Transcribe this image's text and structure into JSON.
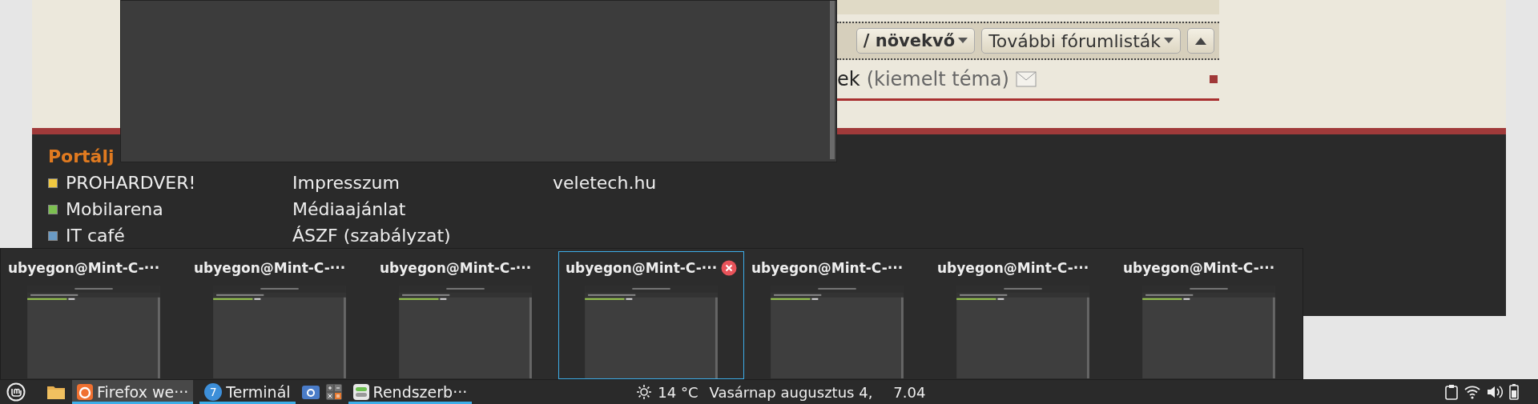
{
  "forum_page": {
    "sort_bar": {
      "sort_label": "/ növekvő",
      "forum_lists_button": "További fórumlisták"
    },
    "topic_row": {
      "title": "ek",
      "note": "(kiemelt téma)"
    },
    "footer": {
      "heading": "Portálj",
      "portals": [
        {
          "label": "PROHARDVER!",
          "color": "#f0c840"
        },
        {
          "label": "Mobilarena",
          "color": "#7cc050"
        },
        {
          "label": "IT café",
          "color": "#6a9ac4"
        }
      ],
      "company_links": [
        "Impresszum",
        "Médiaajánlat",
        "ÁSZF (szabályzat)"
      ],
      "partner_links": [
        "veletech.hu"
      ]
    }
  },
  "window_switcher": {
    "windows": [
      {
        "title": "ubyegon@Mint-C-···",
        "selected": false
      },
      {
        "title": "ubyegon@Mint-C-···",
        "selected": false
      },
      {
        "title": "ubyegon@Mint-C-···",
        "selected": false
      },
      {
        "title": "ubyegon@Mint-C-···",
        "selected": true
      },
      {
        "title": "ubyegon@Mint-C-···",
        "selected": false
      },
      {
        "title": "ubyegon@Mint-C-···",
        "selected": false
      },
      {
        "title": "ubyegon@Mint-C-···",
        "selected": false
      }
    ]
  },
  "taskbar": {
    "windows": [
      {
        "kind": "firefox",
        "label": "Firefox we···",
        "selected": true
      },
      {
        "kind": "terminal",
        "label": "Terminál",
        "badge": "7",
        "selected": false
      },
      {
        "kind": "camera"
      },
      {
        "kind": "calculator"
      },
      {
        "kind": "settings",
        "label": "Rendszerb···",
        "selected": false
      }
    ],
    "weather": "14 °C",
    "date": "Vasárnap augusztus 4,",
    "time": "7.04"
  }
}
